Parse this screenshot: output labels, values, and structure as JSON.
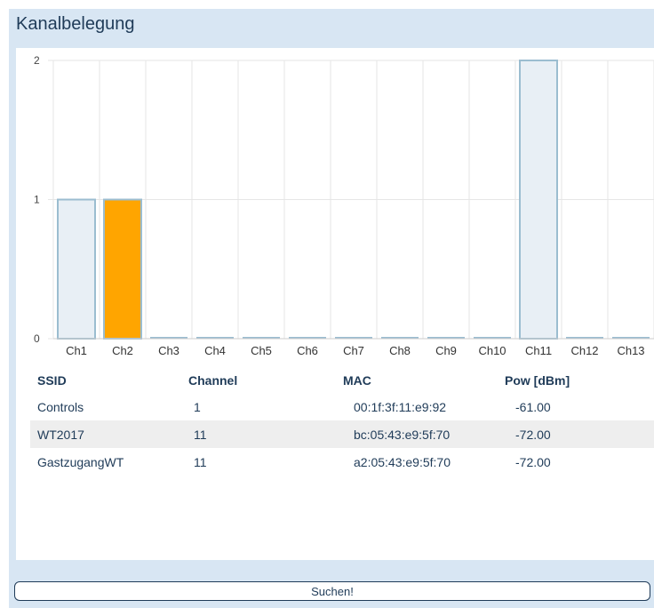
{
  "title": "Kanalbelegung",
  "chart_data": {
    "type": "bar",
    "categories": [
      "Ch1",
      "Ch2",
      "Ch3",
      "Ch4",
      "Ch5",
      "Ch6",
      "Ch7",
      "Ch8",
      "Ch9",
      "Ch10",
      "Ch11",
      "Ch12",
      "Ch13"
    ],
    "values": [
      1,
      1,
      0,
      0,
      0,
      0,
      0,
      0,
      0,
      0,
      2,
      0,
      0
    ],
    "highlight_index": 1,
    "ylim": [
      0,
      2
    ],
    "yticks": [
      "0",
      "1",
      "2"
    ],
    "colors": {
      "bar_fill": "#e8eff5",
      "bar_stroke": "#9bbdd0",
      "highlight_fill": "#ffa500",
      "grid": "#e6e6e6"
    },
    "grid": true
  },
  "table": {
    "headers": {
      "ssid": "SSID",
      "channel": "Channel",
      "mac": "MAC",
      "pow": "Pow [dBm]"
    },
    "rows": [
      {
        "ssid": "Controls",
        "channel": "1",
        "mac": "00:1f:3f:11:e9:92",
        "pow": "-61.00"
      },
      {
        "ssid": "WT2017",
        "channel": "11",
        "mac": "bc:05:43:e9:5f:70",
        "pow": "-72.00"
      },
      {
        "ssid": "GastzugangWT",
        "channel": "11",
        "mac": "a2:05:43:e9:5f:70",
        "pow": "-72.00"
      }
    ]
  },
  "button": {
    "label": "Suchen!"
  }
}
